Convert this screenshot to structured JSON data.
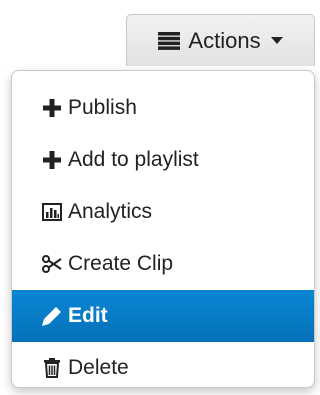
{
  "actions_button": {
    "label": "Actions",
    "icon": "list-icon"
  },
  "menu": {
    "items": [
      {
        "label": "Publish",
        "icon": "plus-icon"
      },
      {
        "label": "Add to playlist",
        "icon": "plus-icon"
      },
      {
        "label": "Analytics",
        "icon": "bar-chart-icon"
      },
      {
        "label": "Create Clip",
        "icon": "scissors-icon"
      },
      {
        "label": "Edit",
        "icon": "pencil-icon",
        "active": true
      },
      {
        "label": "Delete",
        "icon": "trash-icon"
      }
    ]
  },
  "colors": {
    "active_item_bg": "#0a7fcf",
    "active_item_text": "#ffffff",
    "text": "#222222"
  }
}
